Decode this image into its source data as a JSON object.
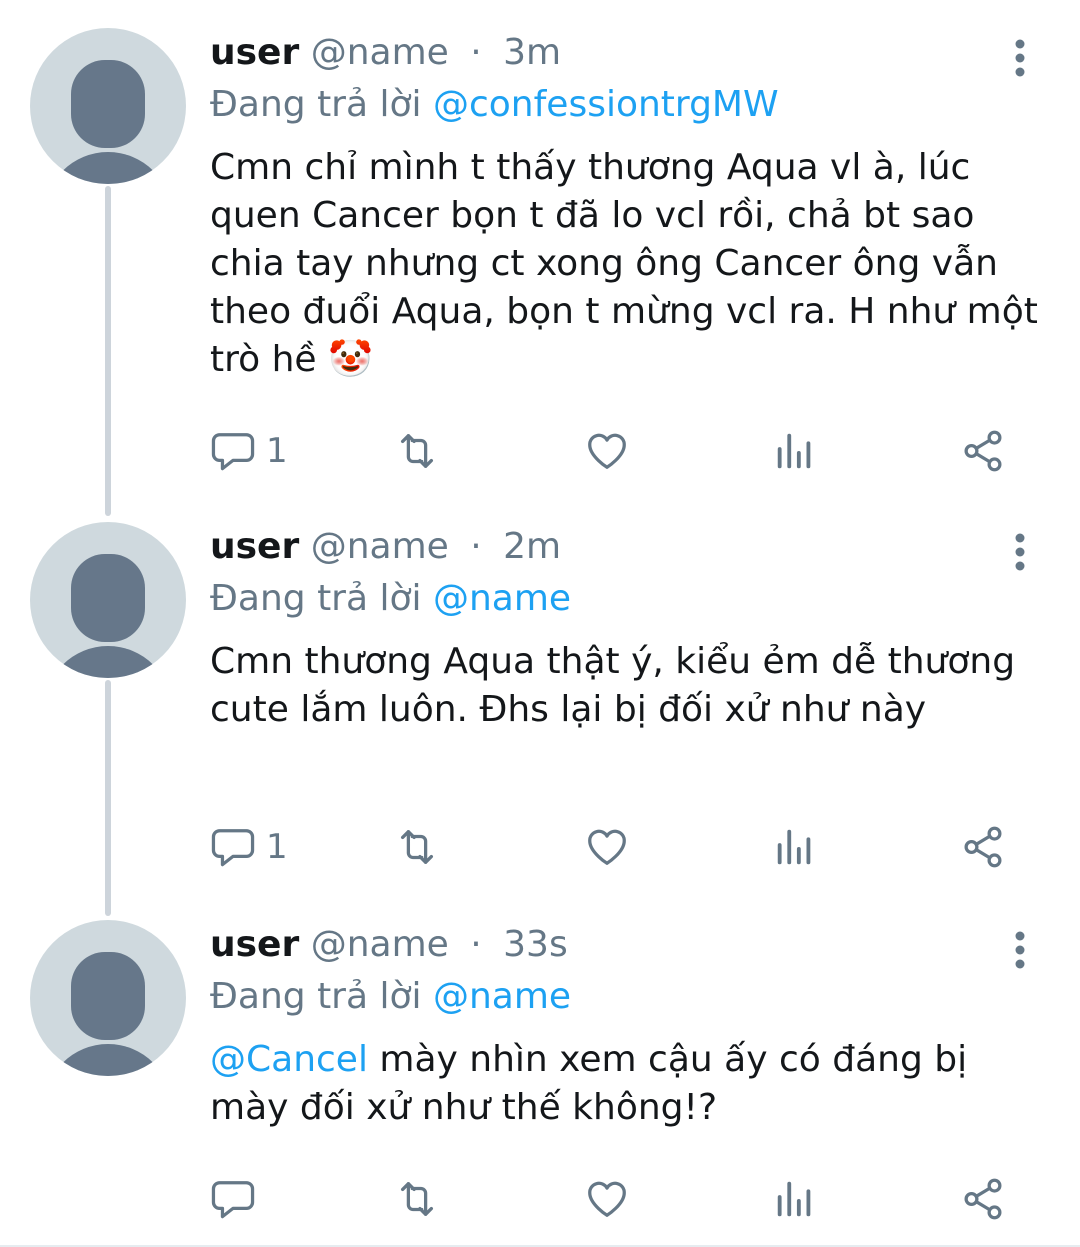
{
  "tweets": [
    {
      "display_name": "user",
      "handle": "@name",
      "separator": "·",
      "time": "3m",
      "reply_prefix": "Đang trả lời",
      "reply_to": "@confessiontrgMW",
      "text": "Cmn chỉ mình t thấy thương Aqua vl à, lúc quen Cancer bọn t đã lo vcl rồi, chả bt sao chia tay nhưng ct xong ông Cancer ông vẫn theo đuổi Aqua, bọn t mừng vcl ra. H như một trò hề 🤡",
      "reply_count": "1"
    },
    {
      "display_name": "user",
      "handle": "@name",
      "separator": "·",
      "time": "2m",
      "reply_prefix": "Đang trả lời",
      "reply_to": "@name",
      "text": "Cmn thương Aqua thật ý, kiểu ẻm dễ thương cute lắm luôn. Đhs lại bị đối xử như này",
      "reply_count": "1"
    },
    {
      "display_name": "user",
      "handle": "@name",
      "separator": "·",
      "time": "33s",
      "reply_prefix": "Đang trả lời",
      "reply_to": "@name",
      "text_mention": "@Cancel",
      "text": " mày nhìn xem cậu ấy có đáng bị mày đối xử như thế không!?",
      "reply_count": ""
    }
  ],
  "icons": {
    "reply": "reply-icon",
    "retweet": "retweet-icon",
    "like": "heart-icon",
    "analytics": "analytics-icon",
    "share": "share-icon",
    "more": "more-vertical-icon"
  },
  "colors": {
    "link": "#1da1f2",
    "secondary": "#657786",
    "avatar_bg": "#cfd9de",
    "avatar_fg": "#66778a",
    "thread_line": "#cdd4db"
  }
}
